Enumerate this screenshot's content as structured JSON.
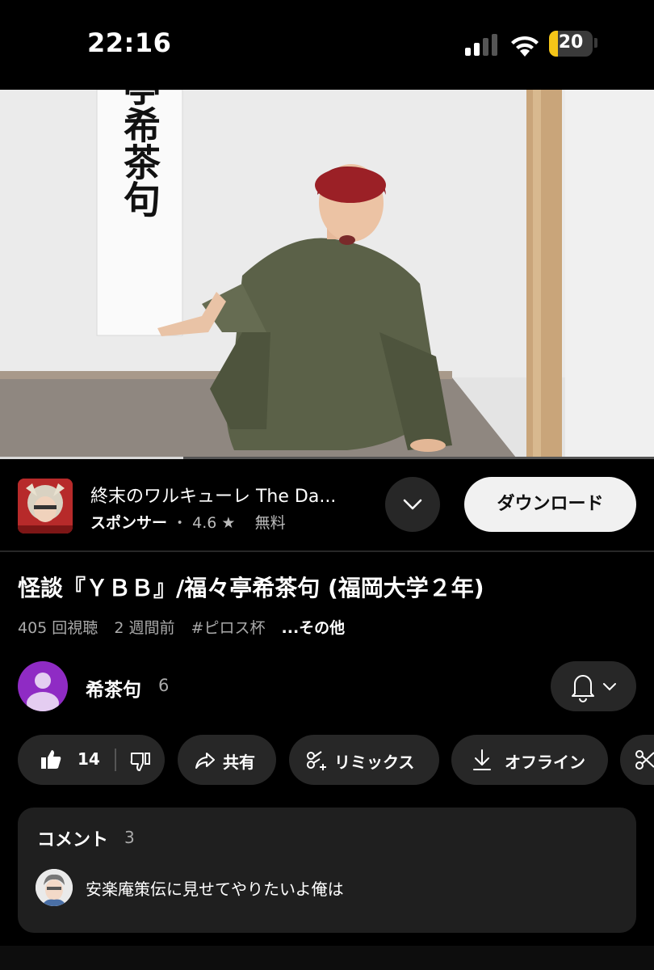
{
  "status_bar": {
    "time": "22:16",
    "battery_level": "20",
    "battery_fraction": 0.2
  },
  "video": {
    "scroll_text": "福々亭希茶句",
    "progress_fraction": 0.28
  },
  "ad": {
    "title": "終末のワルキューレ The Da...",
    "sponsor_label": "スポンサー",
    "separator": "・",
    "rating": "4.6",
    "price": "無料",
    "download_label": "ダウンロード"
  },
  "video_info": {
    "title": "怪談『ＹＢＢ』/福々亭希茶句 (福岡大学２年)",
    "views": "405 回視聴",
    "age": "2 週間前",
    "hashtag": "#ピロス杯",
    "more": "...その他"
  },
  "channel": {
    "name": "希茶句",
    "subscribers": "6"
  },
  "actions": {
    "like_count": "14",
    "share": "共有",
    "remix": "リミックス",
    "offline": "オフライン"
  },
  "comments": {
    "header": "コメント",
    "count": "3",
    "top_comment": "安楽庵策伝に見せてやりたいよ俺は"
  },
  "colors": {
    "background": "#000000",
    "chip": "#272727",
    "card": "#1f1f1f",
    "battery": "#f5c518",
    "channel_avatar": "#8f2bc4"
  }
}
